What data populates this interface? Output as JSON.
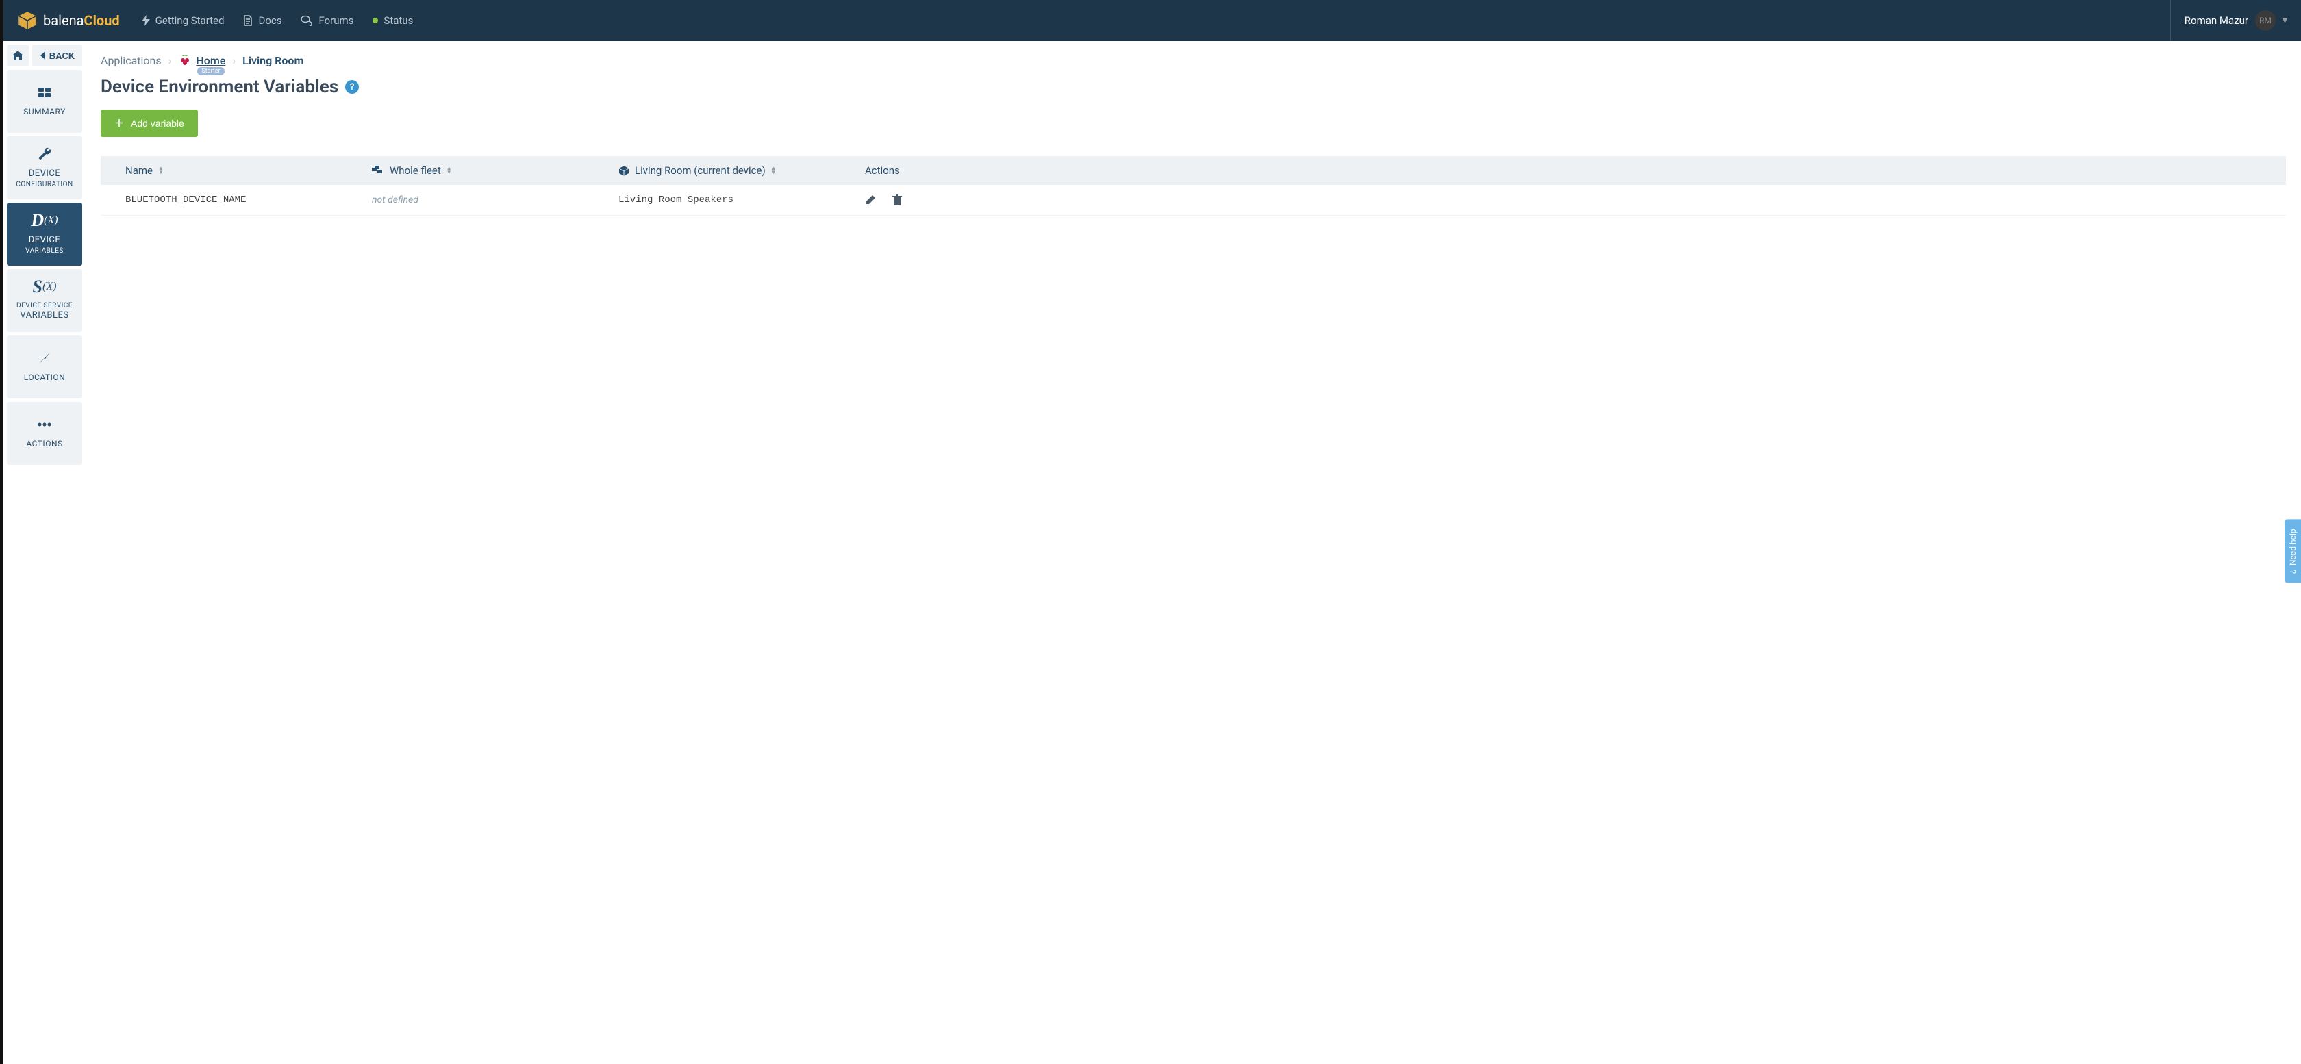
{
  "header": {
    "brand1": "balena",
    "brand2": "Cloud",
    "nav": {
      "getting_started": "Getting Started",
      "docs": "Docs",
      "forums": "Forums",
      "status": "Status"
    },
    "user_name": "Roman Mazur",
    "user_initials": "RM"
  },
  "sidebar": {
    "back": "BACK",
    "items": [
      {
        "label": "SUMMARY"
      },
      {
        "label_big": "DEVICE",
        "label_sm": "CONFIGURATION"
      },
      {
        "label_big": "DEVICE",
        "label_sm": "VARIABLES"
      },
      {
        "label_sm": "DEVICE SERVICE",
        "label_big": "VARIABLES"
      },
      {
        "label": "LOCATION"
      },
      {
        "label": "ACTIONS"
      }
    ]
  },
  "breadcrumb": {
    "root": "Applications",
    "app": "Home",
    "badge": "Starter",
    "device": "Living Room"
  },
  "page_title": "Device Environment Variables",
  "add_button": "Add variable",
  "table": {
    "columns": {
      "name": "Name",
      "fleet": "Whole fleet",
      "device": "Living Room (current device)",
      "actions": "Actions"
    },
    "rows": [
      {
        "name": "BLUETOOTH_DEVICE_NAME",
        "fleet": "not defined",
        "device": "Living Room Speakers"
      }
    ]
  },
  "need_help": "Need help"
}
